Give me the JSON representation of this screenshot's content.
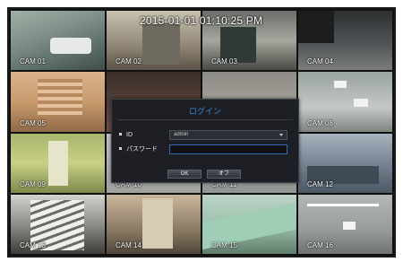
{
  "clock": "2015-01-01 01:10:25 PM",
  "cameras": [
    {
      "label": "CAM 01"
    },
    {
      "label": "CAM 02"
    },
    {
      "label": "CAM 03"
    },
    {
      "label": "CAM 04"
    },
    {
      "label": "CAM 05"
    },
    {
      "label": ""
    },
    {
      "label": ""
    },
    {
      "label": "CAM 08"
    },
    {
      "label": "CAM 09"
    },
    {
      "label": "CAM 10"
    },
    {
      "label": "CAM 11"
    },
    {
      "label": "CAM 12"
    },
    {
      "label": "CAM 13"
    },
    {
      "label": "CAM 14"
    },
    {
      "label": "CAM 15"
    },
    {
      "label": "CAM 16"
    }
  ],
  "login": {
    "title": "ログイン",
    "id_label": "ID",
    "id_value": "admin",
    "password_label": "パスワード",
    "password_value": "",
    "ok_label": "OK",
    "cancel_label": "オフ"
  },
  "colors": {
    "accent": "#2f86d6",
    "dialog_bg": "#1d1f24"
  }
}
